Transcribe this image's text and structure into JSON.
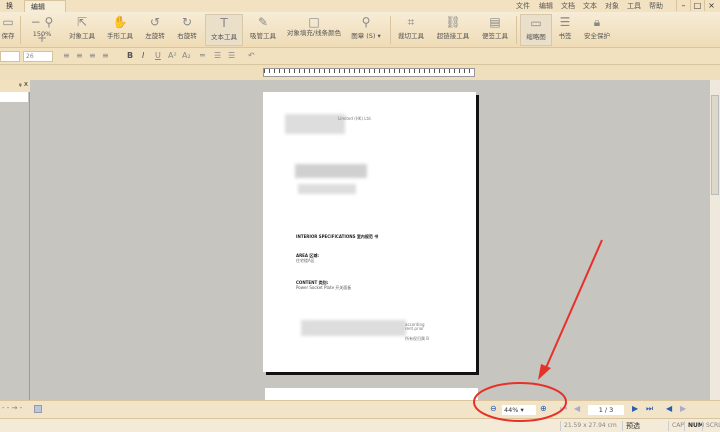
{
  "tabs": [
    "换",
    "编辑"
  ],
  "menu": [
    "文件",
    "编辑",
    "文档",
    "文本",
    "对象",
    "工具",
    "帮助"
  ],
  "window": {
    "minimize": "–",
    "maximize": "□",
    "close": "×"
  },
  "toolbar": {
    "save": "保存",
    "zoom_level": "150%",
    "zoom_out": "−",
    "zoom_in": "+",
    "tools": [
      "对象工具",
      "手形工具",
      "左旋转",
      "右旋转",
      "文本工具",
      "吸管工具",
      "对象填充/线条颜色",
      "图章 (S)",
      "裁切工具",
      "超链接工具",
      "便签工具",
      "缩略图",
      "书签",
      "安全保护"
    ]
  },
  "format": {
    "font": "",
    "size": "26",
    "bold": "B",
    "italic": "I",
    "underline": "U",
    "superscript": "A²",
    "subscript": "A₂"
  },
  "panel": {
    "pin": "ᵩ",
    "close": "x"
  },
  "document": {
    "header_text": "Limited (HK) Ltd.",
    "title": "INTERIOR SPECIFICATIONS 室内规范 书",
    "area_label": "AREA 区域:",
    "area_value": "住宅楼A区",
    "content_label": "CONTENT 类别:",
    "content_value": "Power Socket Plate 开关面板",
    "footer_a": "according",
    "footer_b": "rent prior",
    "footer_c": "所有权归属 B"
  },
  "zoom": {
    "value": "44%"
  },
  "pagination": {
    "current": "1 / 3"
  },
  "status": {
    "page_size": "21.59 x 27.94 cm",
    "mode": "预选",
    "cap": "CAP",
    "num": "NUM",
    "scrl": "SCRL"
  },
  "colors": {
    "accent": "#2a5db0",
    "annotation": "#e8302a"
  }
}
